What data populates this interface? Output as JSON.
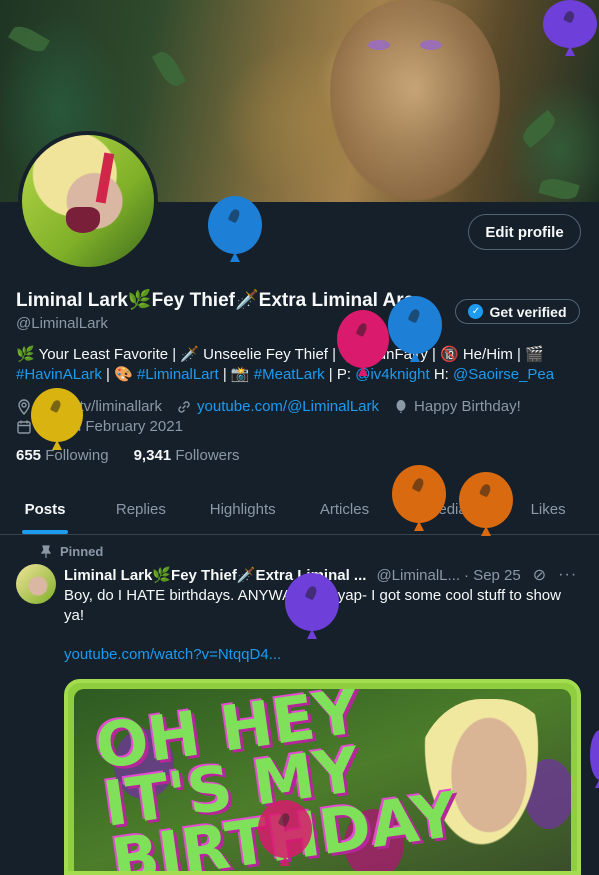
{
  "profile": {
    "display_name": "Liminal Lark🌿Fey Thief🗡️Extra Liminal Arc",
    "handle": "@LiminalLark",
    "edit_profile_label": "Edit profile",
    "get_verified_label": "Get verified",
    "bio_line1": "🌿 Your Least Favorite | 🗡️ Unseelie Fey Thief | 🧚 TsunFairy | 🔞 He/Him | 🎬",
    "bio_tag1": "#HavinALark",
    "bio_sep1": " | 🎨 ",
    "bio_tag2": "#LiminalLart",
    "bio_sep2": " | 📸 ",
    "bio_tag3": "#MeatLark",
    "bio_sep3": " | P: ",
    "bio_tag4": "@iv4knight",
    "bio_sep4": " H: ",
    "bio_tag5": "@Saoirse_Pea",
    "location": "twitch.tv/liminallark",
    "website": "youtube.com/@LiminalLark",
    "birthday": "Happy Birthday!",
    "joined": "Joined February 2021",
    "following_count": "655",
    "following_label": "Following",
    "followers_count": "9,341",
    "followers_label": "Followers"
  },
  "tabs": [
    "Posts",
    "Replies",
    "Highlights",
    "Articles",
    "Media",
    "Likes"
  ],
  "pinned_post": {
    "pinned_label": "Pinned",
    "author_name": "Liminal Lark🌿Fey Thief🗡️Extra Liminal ...",
    "author_handle": "@LiminalL...",
    "date": "· Sep 25",
    "text": "Boy, do I HATE birthdays.  ANYWAY, let's yap- I got some cool stuff to show ya!",
    "link": "youtube.com/watch?v=NtqqD4...",
    "thumbnail_text": "OH HEY\nIT'S MY\nBIRTHDAY"
  },
  "colors": {
    "background": "#15202b",
    "accent": "#1d9bf0",
    "muted_text": "#8b98a5",
    "balloon_blue": "#1d7fd6",
    "balloon_purple": "#6e3fd9",
    "balloon_magenta": "#d91a6d",
    "balloon_orange": "#d96a0f",
    "balloon_yellow": "#d9b30f"
  }
}
